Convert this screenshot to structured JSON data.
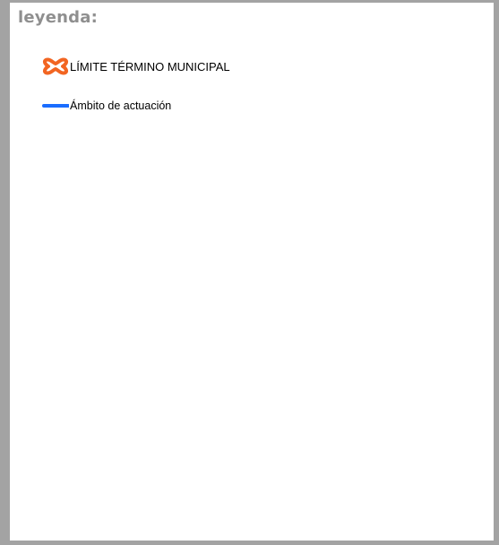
{
  "legend": {
    "title": "leyenda:",
    "items": [
      {
        "label": "LÍMITE TÉRMINO MUNICIPAL",
        "symbol": "municipal-boundary-icon",
        "color": "#f26522"
      },
      {
        "label": "Ámbito de actuación",
        "symbol": "action-area-line-icon",
        "color": "#1a6dff"
      }
    ]
  },
  "colors": {
    "frame": "#a3a3a3",
    "title": "#8f8f8f",
    "background": "#ffffff"
  }
}
